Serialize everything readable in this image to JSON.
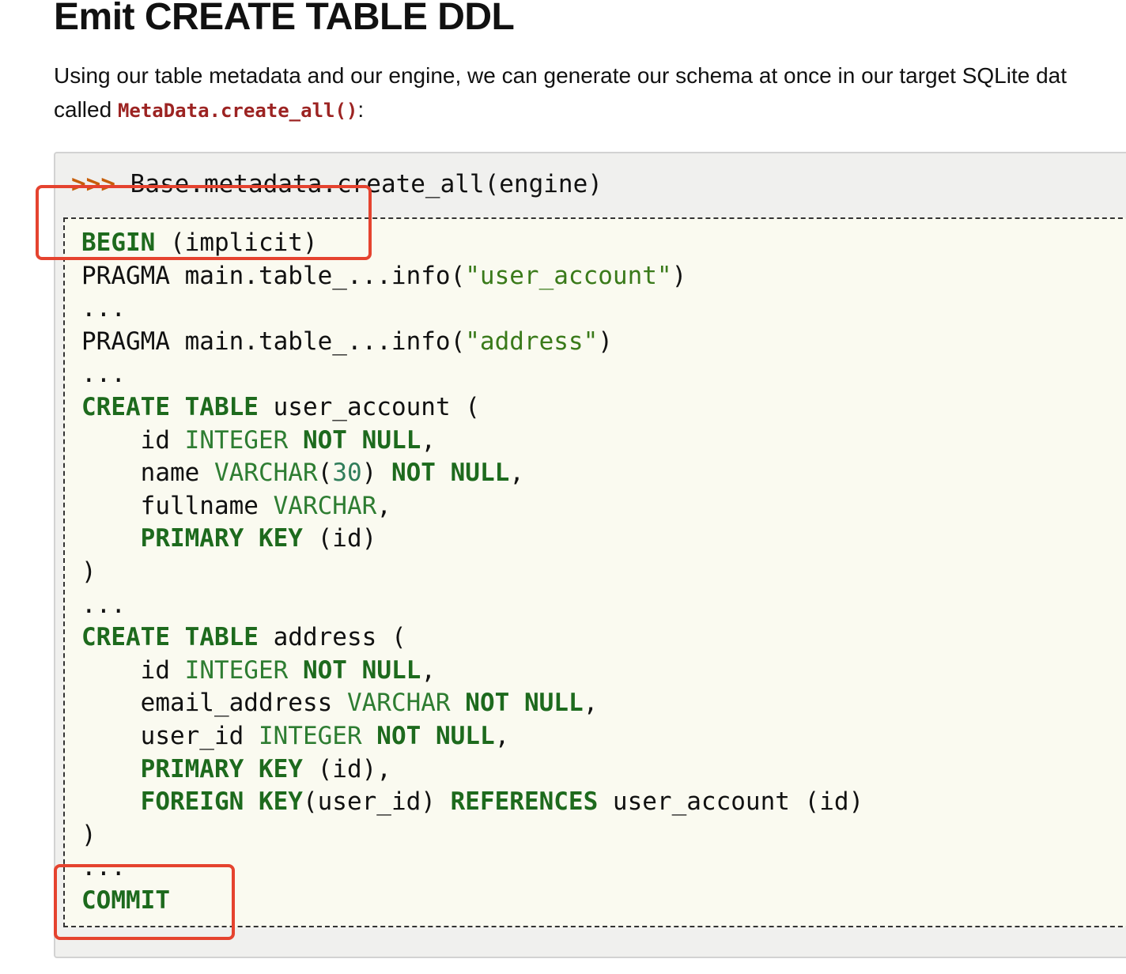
{
  "page": {
    "title": "Emit CREATE TABLE DDL",
    "intro": {
      "line1": "Using our table metadata and our engine, we can generate our schema at once in our target SQLite dat",
      "line2_prefix": "called ",
      "line2_code": "MetaData.create_all()",
      "line2_suffix": ":"
    }
  },
  "code": {
    "prompt": ">>>",
    "command": " Base.metadata.create_all(engine)",
    "output": {
      "l1": {
        "a": "BEGIN",
        "b": " (implicit)"
      },
      "l2": {
        "a": "PRAGMA main.table_...info(",
        "b": "\"user_account\"",
        "c": ")"
      },
      "l3": {
        "a": "..."
      },
      "l4": {
        "a": "PRAGMA main.table_...info(",
        "b": "\"address\"",
        "c": ")"
      },
      "l5": {
        "a": "..."
      },
      "l6": {
        "a": "CREATE",
        "b": " ",
        "c": "TABLE",
        "d": " user_account ("
      },
      "l7": {
        "a": "    id ",
        "b": "INTEGER",
        "c": " ",
        "d": "NOT",
        "e": " ",
        "f": "NULL",
        "g": ","
      },
      "l8": {
        "a": "    name ",
        "b": "VARCHAR",
        "c": "(",
        "d": "30",
        "e": ") ",
        "f": "NOT",
        "g": " ",
        "h": "NULL",
        "i": ","
      },
      "l9": {
        "a": "    fullname ",
        "b": "VARCHAR",
        "c": ","
      },
      "l10": {
        "a": "    ",
        "b": "PRIMARY",
        "c": " ",
        "d": "KEY",
        "e": " (id)"
      },
      "l11": {
        "a": ")"
      },
      "l12": {
        "a": "..."
      },
      "l13": {
        "a": "CREATE",
        "b": " ",
        "c": "TABLE",
        "d": " address ("
      },
      "l14": {
        "a": "    id ",
        "b": "INTEGER",
        "c": " ",
        "d": "NOT",
        "e": " ",
        "f": "NULL",
        "g": ","
      },
      "l15": {
        "a": "    email_address ",
        "b": "VARCHAR",
        "c": " ",
        "d": "NOT",
        "e": " ",
        "f": "NULL",
        "g": ","
      },
      "l16": {
        "a": "    user_id ",
        "b": "INTEGER",
        "c": " ",
        "d": "NOT",
        "e": " ",
        "f": "NULL",
        "g": ","
      },
      "l17": {
        "a": "    ",
        "b": "PRIMARY",
        "c": " ",
        "d": "KEY",
        "e": " (id),"
      },
      "l18": {
        "a": "    ",
        "b": "FOREIGN",
        "c": " ",
        "d": "KEY",
        "e": "(user_id) ",
        "f": "REFERENCES",
        "g": " user_account (id)"
      },
      "l19": {
        "a": ")"
      },
      "l20": {
        "a": "..."
      },
      "l21": {
        "a": "COMMIT"
      }
    }
  },
  "colors": {
    "keyword": "#1d6a1d",
    "prompt": "#c65d09",
    "inline_code": "#9c2322",
    "highlight_box": "#e5432f"
  }
}
